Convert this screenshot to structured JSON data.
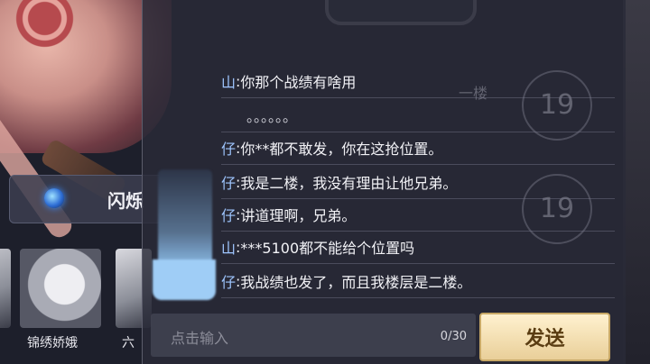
{
  "background": {
    "spell_name": "闪烁",
    "heroes": [
      {
        "name": ""
      },
      {
        "name": "锦绣娇娥"
      },
      {
        "name": "六"
      }
    ],
    "floor_numbers": [
      "19",
      "19"
    ],
    "floor_label": "一楼"
  },
  "chat": {
    "messages": [
      {
        "sender": "山",
        "sep": ": ",
        "text": "你那个战绩有啥用"
      },
      {
        "sender": "",
        "sep": "",
        "text": "。。。。。。"
      },
      {
        "sender": "仔",
        "sep": ": ",
        "text": "你**都不敢发，你在这抢位置。"
      },
      {
        "sender": "仔",
        "sep": ": ",
        "text": "我是二楼，我没有理由让他兄弟。"
      },
      {
        "sender": "仔",
        "sep": ": ",
        "text": "讲道理啊，兄弟。"
      },
      {
        "sender": "山",
        "sep": ": ",
        "text": "***5100都不能给个位置吗"
      },
      {
        "sender": "仔",
        "sep": ": ",
        "text": "我战绩也发了，而且我楼层是二楼。"
      }
    ],
    "input": {
      "placeholder": "点击输入",
      "counter": "0/30"
    },
    "send_label": "发送"
  },
  "colors": {
    "sender": "#9fc6ff",
    "send_button": "#f4dfb0",
    "panel": "#2a2b38"
  }
}
